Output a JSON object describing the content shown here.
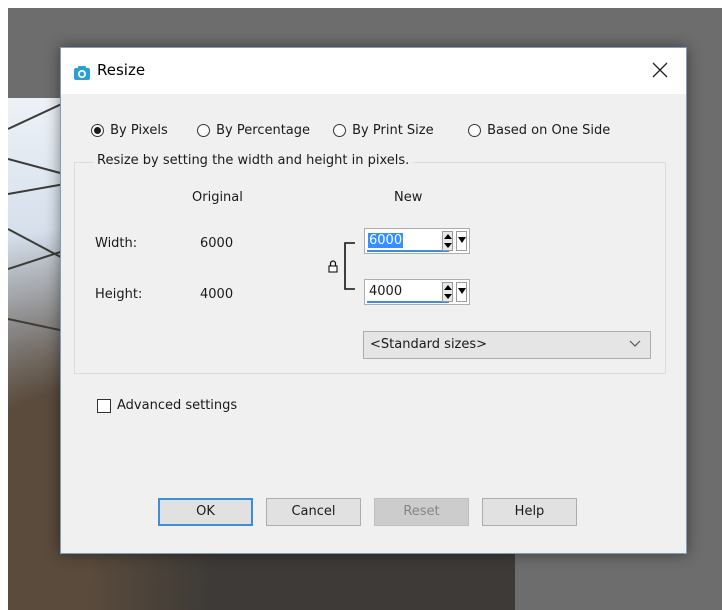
{
  "dialog": {
    "title": "Resize",
    "close_glyph": "×"
  },
  "modes": [
    {
      "label": "By Pixels",
      "checked": true
    },
    {
      "label": "By Percentage",
      "checked": false
    },
    {
      "label": "By Print Size",
      "checked": false
    },
    {
      "label": "Based on One Side",
      "checked": false
    }
  ],
  "group": {
    "legend": "Resize by setting the width and height in pixels.",
    "col_original": "Original",
    "col_new": "New"
  },
  "width": {
    "label": "Width:",
    "original": "6000",
    "new": "6000"
  },
  "height": {
    "label": "Height:",
    "original": "4000",
    "new": "4000"
  },
  "lock_icon": "padlock-icon",
  "standard_sizes": {
    "selected": "<Standard sizes>"
  },
  "advanced": {
    "label": "Advanced settings",
    "checked": false
  },
  "buttons": {
    "ok": "OK",
    "cancel": "Cancel",
    "reset": "Reset",
    "help": "Help",
    "reset_disabled": true
  },
  "colors": {
    "accent": "#3c8fd6",
    "icon_teal": "#2a9fd6",
    "selection": "#3390ff"
  }
}
